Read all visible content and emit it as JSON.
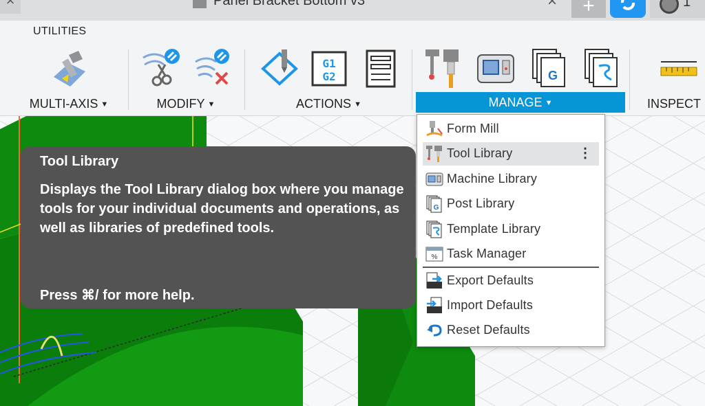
{
  "titlebar": {
    "document_title": "Panel Bracket Bottom v3",
    "user_count": "1"
  },
  "toolbar": {
    "tab": "UTILITIES",
    "groups": [
      {
        "label": "MULTI-AXIS"
      },
      {
        "label": "MODIFY"
      },
      {
        "label": "ACTIONS"
      },
      {
        "label": "MANAGE"
      },
      {
        "label": "INSPECT"
      }
    ],
    "gcode_icon_text": [
      "G1",
      "G2"
    ],
    "post_icon_letter": "G",
    "dropdown_arrow": "▼",
    "active_color": "#0696d7"
  },
  "manage_menu": {
    "items": [
      {
        "label": "Form Mill",
        "icon": "form-mill-icon"
      },
      {
        "label": "Tool Library",
        "icon": "tool-library-icon",
        "highlighted": true
      },
      {
        "label": "Machine Library",
        "icon": "machine-library-icon"
      },
      {
        "label": "Post Library",
        "icon": "post-library-icon"
      },
      {
        "label": "Template Library",
        "icon": "template-library-icon"
      },
      {
        "label": "Task Manager",
        "icon": "task-manager-icon"
      },
      {
        "label": "Export Defaults",
        "icon": "export-defaults-icon"
      },
      {
        "label": "Import Defaults",
        "icon": "import-defaults-icon"
      },
      {
        "label": "Reset Defaults",
        "icon": "reset-defaults-icon"
      }
    ],
    "kebab": "⋮",
    "task_manager_glyph": "%",
    "post_glyph": "G"
  },
  "tooltip": {
    "title": "Tool Library",
    "body": "Displays the Tool Library dialog box where you manage tools for your individual documents and operations, as well as libraries of predefined tools.",
    "help": "Press ⌘/ for more help."
  },
  "colors": {
    "model_green": "#0e8a0e",
    "tooltip_bg": "#535353",
    "highlight": "#e2e3e4"
  }
}
